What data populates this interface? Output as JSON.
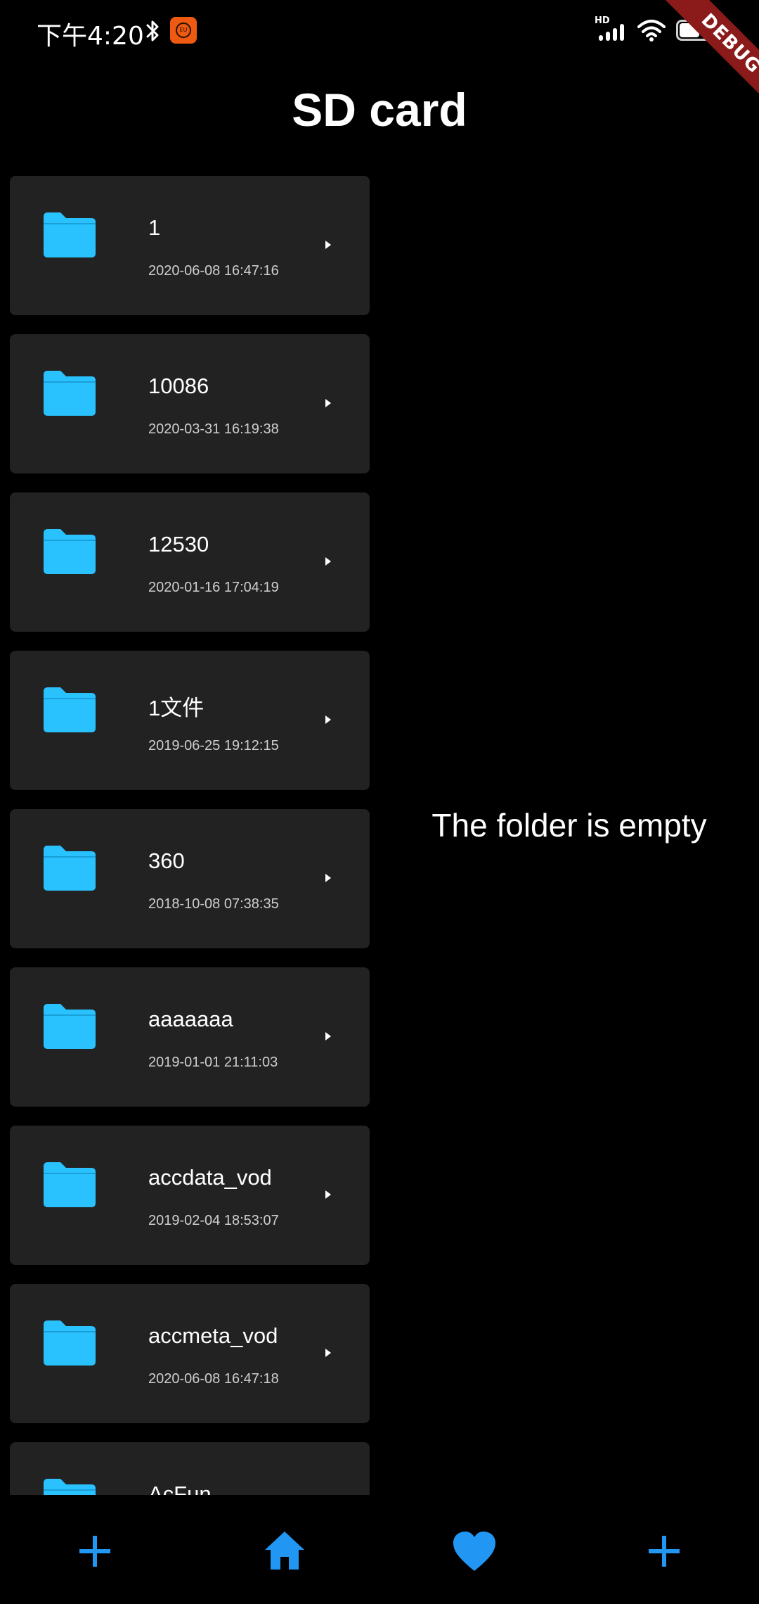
{
  "status_bar": {
    "time": "下午4:20",
    "hd_label": "HD",
    "battery_level": "64"
  },
  "debug_banner": "DEBUG",
  "header": {
    "title": "SD card"
  },
  "colors": {
    "accent": "#2196f3",
    "folder": "#29c2ff",
    "card": "#222222",
    "debug": "#8b1a1a"
  },
  "folders": [
    {
      "name": "1",
      "modified": "2020-06-08 16:47:16"
    },
    {
      "name": "10086",
      "modified": "2020-03-31 16:19:38"
    },
    {
      "name": "12530",
      "modified": "2020-01-16 17:04:19"
    },
    {
      "name": "1文件",
      "modified": "2019-06-25 19:12:15"
    },
    {
      "name": "360",
      "modified": "2018-10-08 07:38:35"
    },
    {
      "name": "aaaaaaa",
      "modified": "2019-01-01 21:11:03"
    },
    {
      "name": "accdata_vod",
      "modified": "2019-02-04 18:53:07"
    },
    {
      "name": "accmeta_vod",
      "modified": "2020-06-08 16:47:18"
    },
    {
      "name": "AcFun",
      "modified": ""
    }
  ],
  "empty_state": "The folder is empty",
  "bottom_nav": {
    "items": [
      {
        "icon": "plus-icon",
        "label": "Add"
      },
      {
        "icon": "home-icon",
        "label": "Home"
      },
      {
        "icon": "heart-icon",
        "label": "Favorites"
      },
      {
        "icon": "plus-icon",
        "label": "Add"
      }
    ]
  }
}
